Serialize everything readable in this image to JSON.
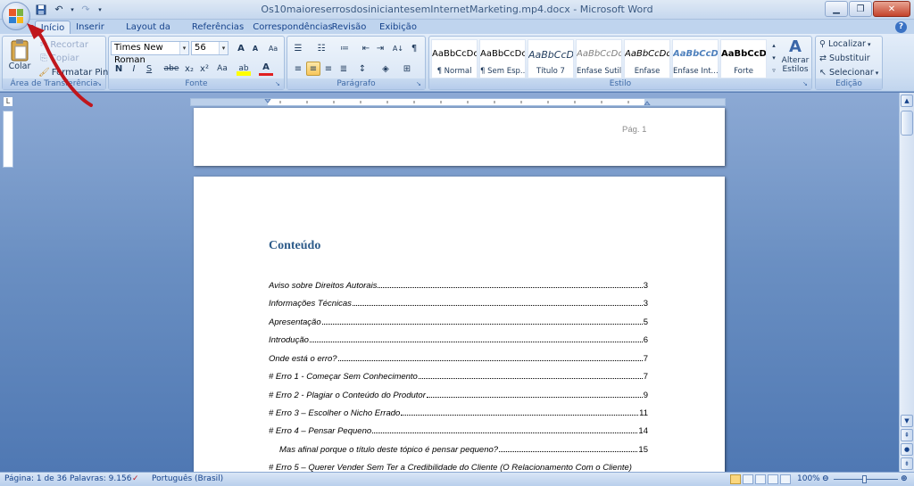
{
  "window": {
    "title": "Os10maioreserrosdosiniciantesemInternetMarketing.mp4.docx - Microsoft Word"
  },
  "tabs": [
    "Início",
    "Inserir",
    "Layout da Página",
    "Referências",
    "Correspondências",
    "Revisão",
    "Exibição"
  ],
  "ribbon": {
    "clipboard": {
      "paste_label": "Colar",
      "cut_label": "Recortar",
      "copy_label": "Copiar",
      "format_painter_label": "Formatar Pincel",
      "group_label": "Área de Transferência"
    },
    "font": {
      "font_name": "Times New Roman",
      "font_size": "56",
      "grow_label": "A",
      "shrink_label": "A",
      "clear_label": "Aa",
      "bold": "N",
      "italic": "I",
      "underline": "S",
      "strike": "abe",
      "subscript": "x₂",
      "superscript": "x²",
      "change_case": "Aa",
      "highlight": "ab",
      "font_color": "A",
      "group_label": "Fonte"
    },
    "paragraph": {
      "group_label": "Parágrafo"
    },
    "styles": {
      "items": [
        {
          "sample": "AaBbCcDc",
          "name": "¶ Normal"
        },
        {
          "sample": "AaBbCcDc",
          "name": "¶ Sem Esp..."
        },
        {
          "sample": "AaBbCcD",
          "name": "Título 7"
        },
        {
          "sample": "AaBbCcDc",
          "name": "Ênfase Sutil"
        },
        {
          "sample": "AaBbCcDc",
          "name": "Ênfase"
        },
        {
          "sample": "AaBbCcDc",
          "name": "Ênfase Int..."
        },
        {
          "sample": "AaBbCcDc",
          "name": "Forte"
        }
      ],
      "change_styles_label": "Alterar Estilos",
      "group_label": "Estilo"
    },
    "editing": {
      "find_label": "Localizar",
      "replace_label": "Substituir",
      "select_label": "Selecionar",
      "group_label": "Edição"
    }
  },
  "document": {
    "header_page_label": "Pág. 1",
    "toc_title": "Conteúdo",
    "toc": [
      {
        "text": "Aviso sobre Direitos Autorais",
        "page": "3",
        "indent": false
      },
      {
        "text": "Informações Técnicas",
        "page": "3",
        "indent": false
      },
      {
        "text": "Apresentação",
        "page": "5",
        "indent": false
      },
      {
        "text": "Introdução",
        "page": "6",
        "indent": false
      },
      {
        "text": "Onde está o erro?",
        "page": "7",
        "indent": false
      },
      {
        "text": "# Erro 1 - Começar Sem Conhecimento",
        "page": "7",
        "indent": false
      },
      {
        "text": "# Erro 2 - Plagiar o Conteúdo do Produtor",
        "page": "9",
        "indent": false
      },
      {
        "text": "# Erro 3 – Escolher o Nicho Errado",
        "page": "11",
        "indent": false
      },
      {
        "text": "# Erro 4 – Pensar Pequeno",
        "page": "14",
        "indent": false
      },
      {
        "text": "Mas afinal porque o título deste tópico é pensar pequeno?",
        "page": "15",
        "indent": true
      },
      {
        "text": "# Erro 5 – Querer Vender Sem Ter a Credibilidade do Cliente (O Relacionamento Com o Cliente)",
        "page": "",
        "indent": false
      }
    ]
  },
  "statusbar": {
    "page": "Página: 1 de 36",
    "words": "Palavras: 9.156",
    "language": "Português (Brasil)",
    "zoom": "100%"
  },
  "colors": {
    "toc_title": "#2e5c8a",
    "annotation_arrow": "#c0161c",
    "workspace": "#6a8fc2"
  }
}
